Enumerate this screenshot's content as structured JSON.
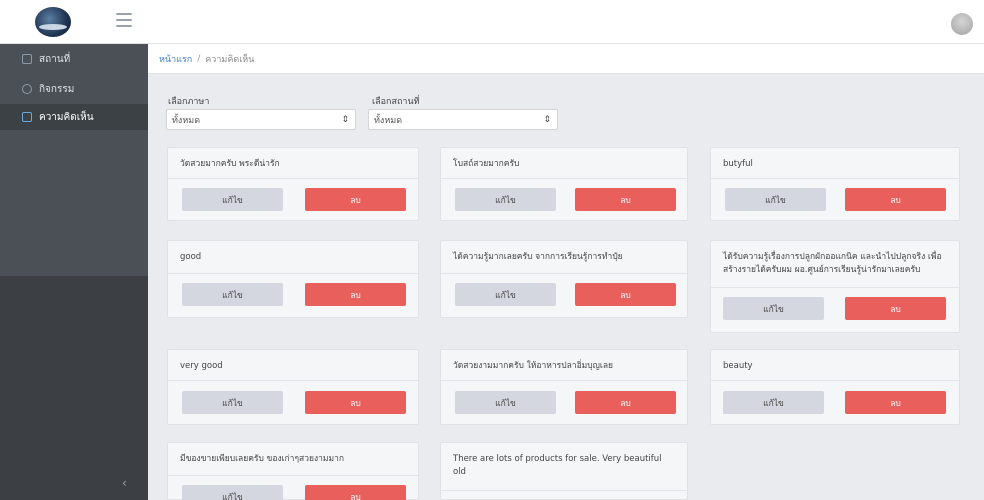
{
  "sidebar": {
    "items": [
      {
        "label": "สถานที่"
      },
      {
        "label": "กิจกรรม"
      },
      {
        "label": "ความคิดเห็น"
      }
    ],
    "collapse_icon": "‹"
  },
  "breadcrumb": {
    "home": "หน้าแรก",
    "separator": "/",
    "current": "ความคิดเห็น"
  },
  "filters": {
    "language": {
      "label": "เลือกภาษา",
      "value": "ทั้งหมด"
    },
    "place": {
      "label": "เลือกสถานที่",
      "value": "ทั้งหมด"
    }
  },
  "buttons": {
    "edit": "แก้ไข",
    "delete": "ลบ"
  },
  "comments": [
    {
      "text": "วัดสวยมากครับ พระดีน่ารัก"
    },
    {
      "text": "โบสถ์สวยมากครับ"
    },
    {
      "text": "butyful"
    },
    {
      "text": "good"
    },
    {
      "text": "ได้ความรู้มากเลยครับ จากการเรียนรู้การทำปุ๋ย"
    },
    {
      "text": "ได้รับความรู้เรื่องการปลูกผักออแกนิค และนำไปปลูกจริง เพื่อสร้างรายได้ครับผม ผอ.ศูนย์การเรียนรู้น่ารักมาเลยครับ"
    },
    {
      "text": "very good"
    },
    {
      "text": "วัดสวยงามมากครับ ให้อาหารปลาอิ่มบุญเลย"
    },
    {
      "text": "beauty"
    },
    {
      "text": "มีของขายเพียบเลยครับ ของเก่าๆสวยงามมาก"
    },
    {
      "text": "There are lots of products for sale. Very beautiful old"
    }
  ]
}
